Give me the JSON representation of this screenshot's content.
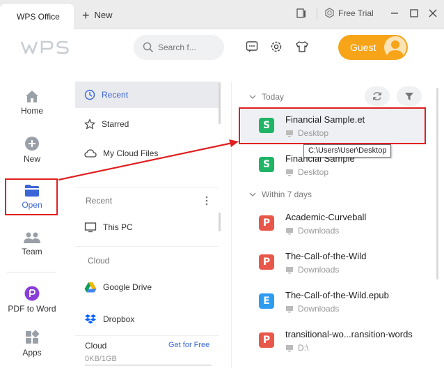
{
  "titlebar": {
    "tab_label": "WPS Office",
    "new_tab_label": "New",
    "free_trial": "Free Trial"
  },
  "header": {
    "logo_text": "WPS",
    "search_placeholder": "Search f...",
    "guest_label": "Guest"
  },
  "rail": {
    "home": "Home",
    "new": "New",
    "open": "Open",
    "team": "Team",
    "pdf_to_word": "PDF to Word",
    "apps": "Apps"
  },
  "middle": {
    "recent": "Recent",
    "starred": "Starred",
    "my_cloud_files": "My Cloud Files",
    "recent_section": "Recent",
    "this_pc": "This PC",
    "cloud_section": "Cloud",
    "google_drive": "Google Drive",
    "dropbox": "Dropbox",
    "cloud_footer_label": "Cloud",
    "get_for_free": "Get for Free",
    "storage": "0KB/1GB"
  },
  "files": {
    "today_label": "Today",
    "within7_label": "Within 7 days",
    "items": [
      {
        "name": "Financial Sample.et",
        "location": "Desktop",
        "type": "S"
      },
      {
        "name": "Financial Sample",
        "location": "Desktop",
        "type": "S"
      },
      {
        "name": "Academic-Curveball",
        "location": "Downloads",
        "type": "P"
      },
      {
        "name": "The-Call-of-the-Wild",
        "location": "Downloads",
        "type": "P"
      },
      {
        "name": "The-Call-of-the-Wild.epub",
        "location": "Downloads",
        "type": "E"
      },
      {
        "name": "transitional-wo...ransition-words",
        "location": "D:\\",
        "type": "P"
      }
    ],
    "tooltip": "C:\\Users\\User\\Desktop"
  },
  "colors": {
    "accent_blue": "#3b66d6",
    "guest_orange": "#f7a419",
    "sheet_green": "#1fb466",
    "pdf_red": "#e8584a",
    "epub_blue": "#2e9cf0",
    "annotation_red": "#e02020"
  }
}
